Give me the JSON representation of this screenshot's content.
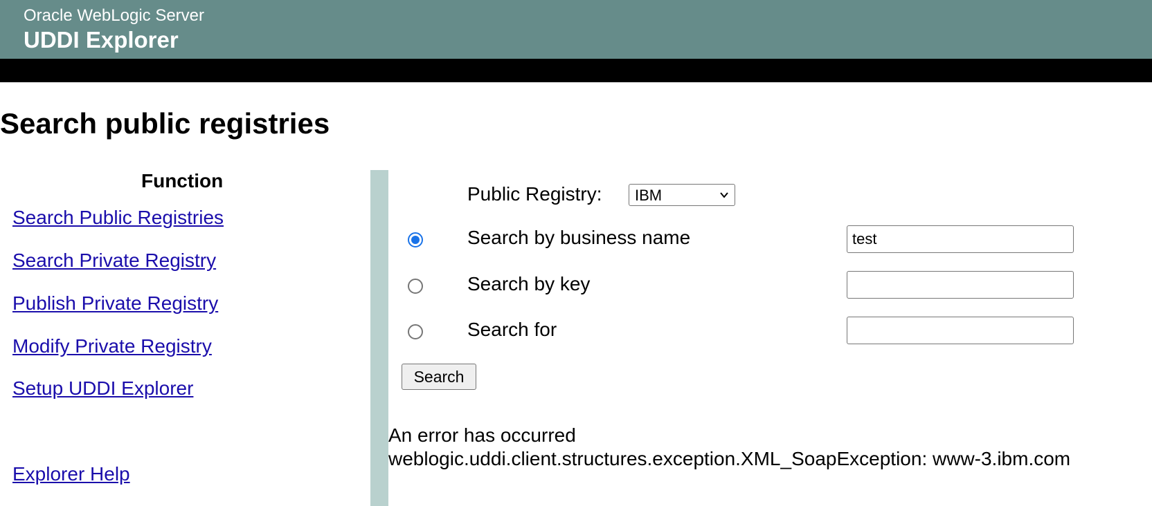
{
  "header": {
    "product_name": "Oracle WebLogic Server",
    "app_name": "UDDI Explorer"
  },
  "page": {
    "title": "Search public registries"
  },
  "sidebar": {
    "heading": "Function",
    "links": [
      "Search Public Registries",
      "Search Private Registry",
      "Publish Private Registry",
      "Modify Private Registry",
      "Setup UDDI Explorer"
    ],
    "help_link": "Explorer Help"
  },
  "form": {
    "registry_label": "Public Registry:",
    "registry_selected": "IBM",
    "options": [
      {
        "label": "Search by business name",
        "selected": true,
        "value": "test"
      },
      {
        "label": "Search by key",
        "selected": false,
        "value": ""
      },
      {
        "label": "Search for",
        "selected": false,
        "value": ""
      }
    ],
    "search_button": "Search"
  },
  "error": {
    "line1": "An error has occurred",
    "line2": "weblogic.uddi.client.structures.exception.XML_SoapException: www-3.ibm.com"
  },
  "colors": {
    "header_bg": "#668c8a",
    "divider": "#b9d1ce",
    "link": "#1a0dab",
    "radio_selected": "#1a73e8"
  }
}
